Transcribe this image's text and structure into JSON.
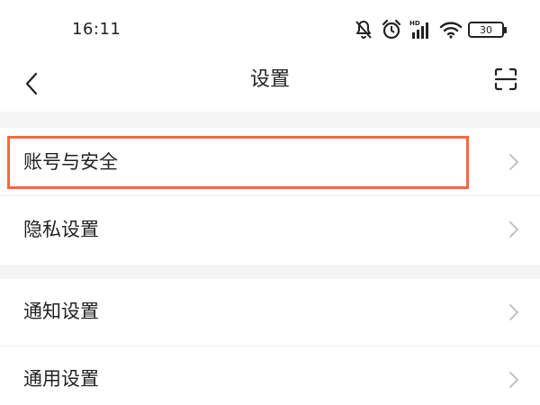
{
  "status_bar": {
    "time": "16:11",
    "battery_level": "30",
    "icons": [
      "mute-icon",
      "alarm-icon",
      "hd-signal-icon",
      "wifi-icon",
      "battery-icon"
    ]
  },
  "nav": {
    "title": "设置",
    "back_icon": "chevron-left-icon",
    "scan_icon": "scan-icon"
  },
  "settings": {
    "group1": [
      {
        "label": "账号与安全",
        "highlighted": true
      },
      {
        "label": "隐私设置",
        "highlighted": false
      }
    ],
    "group2": [
      {
        "label": "通知设置",
        "highlighted": false
      },
      {
        "label": "通用设置",
        "highlighted": false
      }
    ]
  },
  "colors": {
    "highlight": "#ef6b45",
    "separator_bg": "#f5f5f5",
    "chevron": "#bbbbbb"
  }
}
